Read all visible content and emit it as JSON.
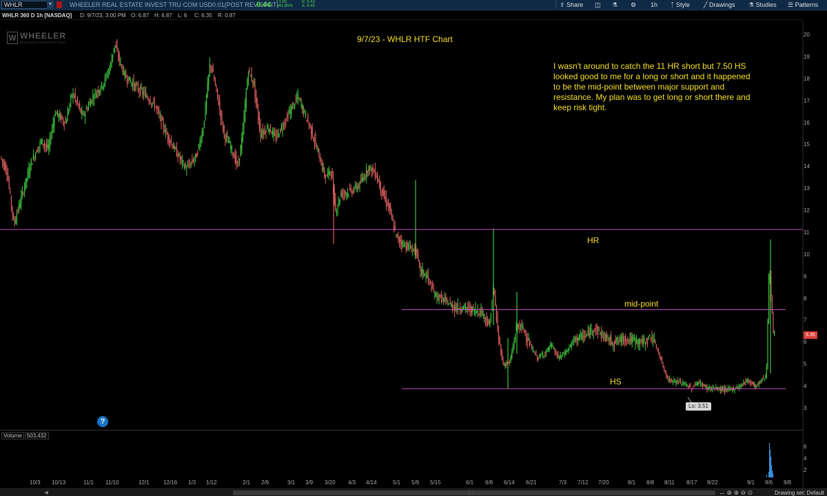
{
  "toolbar": {
    "symbol": "WHLR",
    "company": "WHEELER REAL ESTATE INVEST TRU COM USD0.01(POST REV SPLIT)",
    "last": "6.44",
    "change_abs": "+1.90",
    "change_pct": "+41.85%",
    "bid": "B: 6.43",
    "ask": "A: 6.45",
    "share": "Share",
    "timeframe": "1h",
    "style": "Style",
    "drawings": "Drawings",
    "studies": "Studies",
    "patterns": "Patterns",
    "icon_share": "share-icon",
    "icon_settings": "gear-icon",
    "icon_flask": "flask-icon",
    "colors": {
      "bar": "#0e2a45",
      "up": "#4fd04f",
      "accent": "#a01818"
    }
  },
  "infoline": {
    "chart_id": "WHLR 360 D 1h [NASDAQ]",
    "date": "D: 9/7/23, 3:00 PM",
    "open": "O: 6.87",
    "high": "H: 6.87",
    "low": "L: 6",
    "close": "C: 6.35",
    "range": "R: 0.87"
  },
  "chart": {
    "title": "9/7/23 - WHLR HTF Chart",
    "note": "I wasn't around to catch the 11 HR short but 7.50 HS looked good to me for a long or short and it happened to be the mid-point between major support and resistance. My plan was to get long or short there and keep risk tight.",
    "hr_label": "HR",
    "mid_label": "mid-point",
    "hs_label": "HS",
    "lo_label": "Lo: 3.51",
    "price_tag": "6.35",
    "help": "?",
    "logo_text": "WHEELER",
    "logo_sub": "REAL ESTATE INVESTMENT TRUST",
    "logo_mark": "W",
    "line_color": "#c050c0",
    "up_color": "#3ec83e",
    "down_color": "#e06060"
  },
  "chart_data": {
    "type": "candlestick",
    "yticks": [
      "20",
      "19",
      "18",
      "17",
      "16",
      "15",
      "14",
      "13",
      "12",
      "11",
      "10",
      "9",
      "8",
      "7",
      "6",
      "5",
      "4",
      "3"
    ],
    "ylim": [
      2.5,
      20.7
    ],
    "xticks": [
      "10/3",
      "10/13",
      "11/1",
      "11/10",
      "12/1",
      "12/16",
      "1/3",
      "1/12",
      "2/1",
      "2/9",
      "3/1",
      "3/9",
      "3/20",
      "4/3",
      "4/14",
      "5/1",
      "5/9",
      "5/15",
      "6/1",
      "6/8",
      "6/14",
      "6/21",
      "7/3",
      "7/12",
      "7/20",
      "8/1",
      "8/8",
      "8/11",
      "8/17",
      "8/22",
      "9/1",
      "9/6",
      "9/8"
    ],
    "levels": [
      {
        "name": "HR",
        "value": 11.15
      },
      {
        "name": "mid-point",
        "value": 7.5
      },
      {
        "name": "HS",
        "value": 3.9
      }
    ],
    "low": 3.51,
    "last": 6.35,
    "path": [
      [
        0,
        14.5
      ],
      [
        10,
        13.8
      ],
      [
        20,
        11.4
      ],
      [
        30,
        12.5
      ],
      [
        45,
        14.2
      ],
      [
        60,
        15.2
      ],
      [
        70,
        14.8
      ],
      [
        80,
        16.5
      ],
      [
        95,
        16.0
      ],
      [
        105,
        17.4
      ],
      [
        120,
        16.3
      ],
      [
        135,
        17.2
      ],
      [
        150,
        17.8
      ],
      [
        160,
        18.6
      ],
      [
        166,
        19.6
      ],
      [
        172,
        19.0
      ],
      [
        180,
        18.2
      ],
      [
        195,
        17.7
      ],
      [
        210,
        17.3
      ],
      [
        225,
        16.8
      ],
      [
        240,
        15.6
      ],
      [
        255,
        14.7
      ],
      [
        270,
        13.9
      ],
      [
        285,
        14.5
      ],
      [
        295,
        15.8
      ],
      [
        305,
        18.8
      ],
      [
        315,
        17.3
      ],
      [
        325,
        15.5
      ],
      [
        335,
        14.9
      ],
      [
        345,
        14.0
      ],
      [
        352,
        15.5
      ],
      [
        360,
        18.4
      ],
      [
        368,
        17.8
      ],
      [
        378,
        15.5
      ],
      [
        390,
        15.8
      ],
      [
        400,
        15.3
      ],
      [
        412,
        16.0
      ],
      [
        422,
        16.6
      ],
      [
        432,
        17.2
      ],
      [
        440,
        16.6
      ],
      [
        450,
        15.8
      ],
      [
        462,
        14.6
      ],
      [
        472,
        13.5
      ],
      [
        480,
        13.9
      ],
      [
        487,
        12.0
      ],
      [
        495,
        12.8
      ],
      [
        510,
        12.9
      ],
      [
        522,
        13.2
      ],
      [
        535,
        14.0
      ],
      [
        545,
        13.7
      ],
      [
        555,
        12.8
      ],
      [
        565,
        12.1
      ],
      [
        575,
        10.8
      ],
      [
        585,
        10.5
      ],
      [
        595,
        10.3
      ],
      [
        603,
        10.2
      ],
      [
        610,
        9.3
      ],
      [
        620,
        9.0
      ],
      [
        630,
        8.2
      ],
      [
        645,
        7.9
      ],
      [
        660,
        7.6
      ],
      [
        672,
        7.6
      ],
      [
        685,
        7.5
      ],
      [
        700,
        7.4
      ],
      [
        710,
        6.7
      ],
      [
        716,
        8.6
      ],
      [
        722,
        6.5
      ],
      [
        730,
        5.0
      ],
      [
        740,
        5.1
      ],
      [
        750,
        6.8
      ],
      [
        760,
        6.6
      ],
      [
        770,
        5.8
      ],
      [
        780,
        5.3
      ],
      [
        790,
        5.5
      ],
      [
        800,
        5.9
      ],
      [
        810,
        5.3
      ],
      [
        822,
        5.6
      ],
      [
        835,
        6.2
      ],
      [
        850,
        6.3
      ],
      [
        862,
        6.7
      ],
      [
        875,
        6.3
      ],
      [
        890,
        6.0
      ],
      [
        905,
        6.2
      ],
      [
        920,
        6.1
      ],
      [
        935,
        6.0
      ],
      [
        945,
        6.3
      ],
      [
        955,
        5.6
      ],
      [
        962,
        4.9
      ],
      [
        970,
        4.3
      ],
      [
        985,
        4.2
      ],
      [
        995,
        4.1
      ],
      [
        1003,
        3.9
      ],
      [
        1012,
        4.2
      ],
      [
        1025,
        3.95
      ],
      [
        1040,
        3.9
      ],
      [
        1055,
        3.85
      ],
      [
        1070,
        3.95
      ],
      [
        1085,
        4.3
      ],
      [
        1097,
        4.0
      ],
      [
        1105,
        4.3
      ],
      [
        1112,
        4.5
      ],
      [
        1116,
        9.5
      ],
      [
        1119,
        8.0
      ],
      [
        1122,
        6.5
      ],
      [
        1124,
        6.35
      ]
    ],
    "volume": {
      "label": "Volume",
      "value": "503,432",
      "yticks": [
        "6",
        "4",
        "2"
      ]
    }
  },
  "bottom": {
    "drawing_set": "Drawing set: Default"
  }
}
